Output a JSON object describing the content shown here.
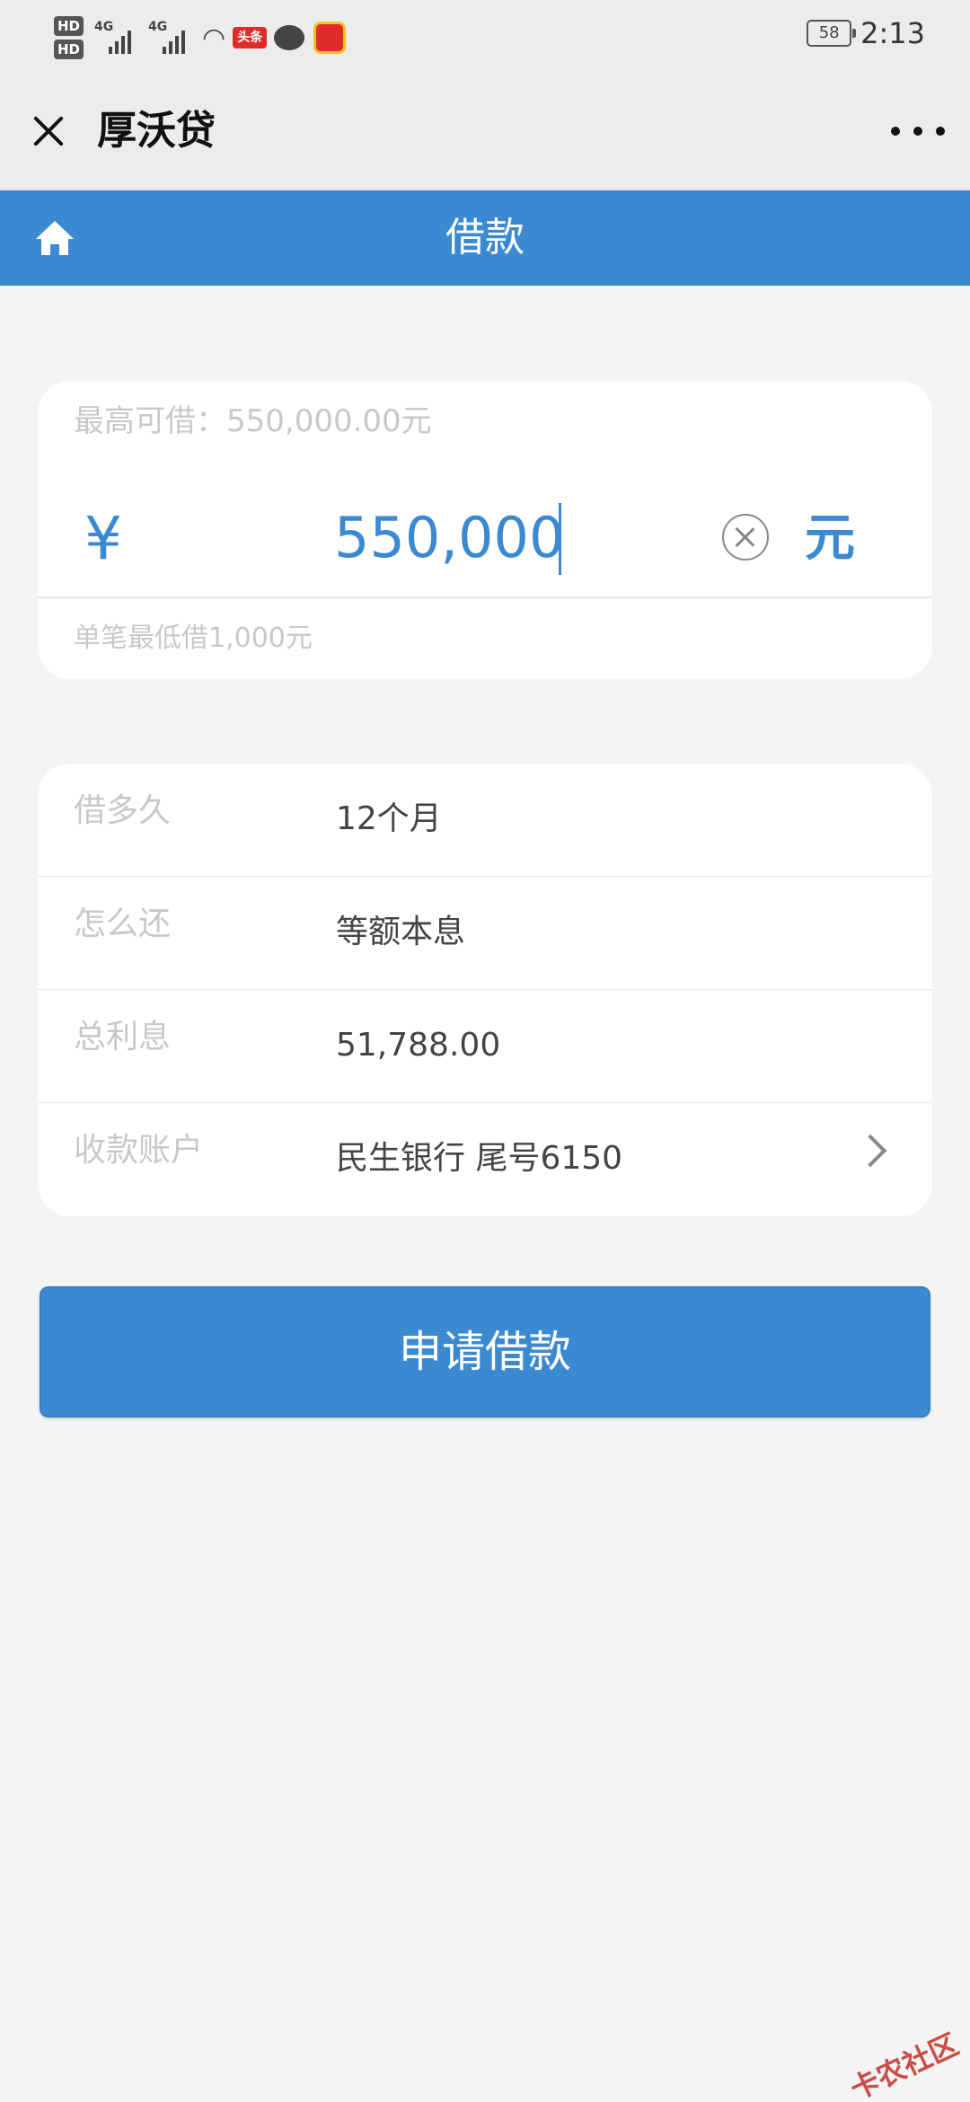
{
  "status_bar": {
    "hd1": "HD",
    "hd2": "HD",
    "network1": "4G",
    "network2": "4G",
    "app_badge": "头条",
    "battery": "58",
    "time": "2:13"
  },
  "title_bar": {
    "app_name": "厚沃贷"
  },
  "header": {
    "title": "借款"
  },
  "amount_card": {
    "max_label": "最高可借：550,000.00元",
    "currency_symbol": "¥",
    "amount_value": "550,000",
    "unit": "元",
    "min_note": "单笔最低借1,000元"
  },
  "details": {
    "rows": [
      {
        "label": "借多久",
        "value": "12个月"
      },
      {
        "label": "怎么还",
        "value": "等额本息"
      },
      {
        "label": "总利息",
        "value": "51,788.00"
      },
      {
        "label": "收款账户",
        "value": "民生银行 尾号6150"
      }
    ]
  },
  "submit_label": "申请借款",
  "watermark": "卡农社区",
  "colors": {
    "accent": "#3a89d1",
    "background": "#f4f4f4"
  }
}
